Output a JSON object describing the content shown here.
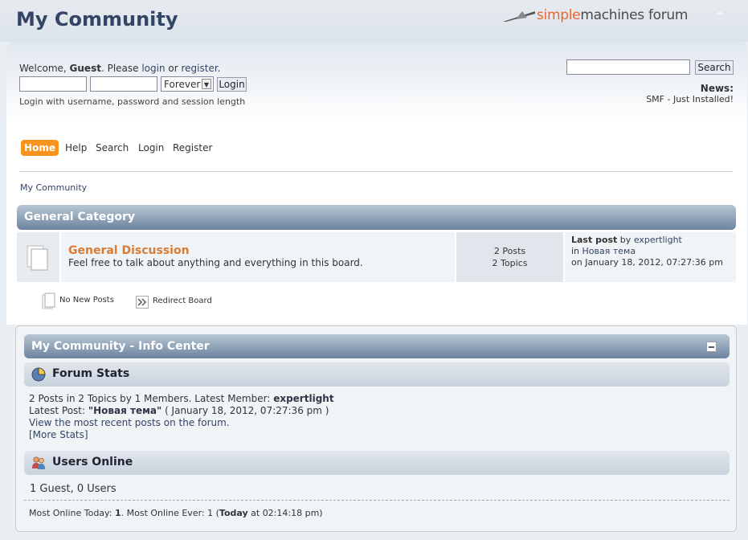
{
  "header": {
    "site_title": "My Community",
    "logo": {
      "simple": "simple",
      "machines": "machines",
      "forum": " forum"
    },
    "collapse_icon": "chevron-up-icon"
  },
  "user": {
    "welcome_prefix": "Welcome, ",
    "guest": "Guest",
    "welcome_mid": ". Please ",
    "login_link": "login",
    "or": " or ",
    "register_link": "register",
    "end": ".",
    "username_value": "",
    "password_value": "",
    "session_length": "Forever",
    "login_button": "Login",
    "login_hint": "Login with username, password and session length"
  },
  "search": {
    "value": "",
    "button": "Search"
  },
  "news": {
    "label": "News:",
    "text": "SMF - Just Installed!"
  },
  "menu": {
    "home": "Home",
    "help": "Help",
    "search": "Search",
    "login": "Login",
    "register": "Register"
  },
  "breadcrumb": "My Community",
  "category": {
    "title": "General Category",
    "board": {
      "name": "General Discussion",
      "description": "Feel free to talk about anything and everything in this board.",
      "posts": "2 Posts",
      "topics": "2 Topics",
      "last_post_label": "Last post",
      "last_post_by": " by ",
      "last_post_author": "expertlight",
      "last_post_in": "in ",
      "last_post_topic": "Новая тема",
      "last_post_on": "on January 18, 2012, 07:27:36 pm"
    }
  },
  "legend": {
    "no_new": "No New Posts",
    "redirect": "Redirect Board"
  },
  "info_center": {
    "title": "My Community - Info Center",
    "stats_title": "Forum Stats",
    "stats_line1_pre": "2 Posts in 2 Topics by 1 Members. Latest Member: ",
    "stats_line1_member": "expertlight",
    "stats_line2_pre": "Latest Post: ",
    "stats_line2_topic": "\"Новая тема\"",
    "stats_line2_post": " ( January 18, 2012, 07:27:36 pm )",
    "stats_line3": "View the most recent posts on the forum.",
    "stats_line4": "[More Stats]",
    "online_title": "Users Online",
    "online_line": "1 Guest, 0 Users",
    "most_online_pre": "Most Online Today: ",
    "most_online_today": "1",
    "most_online_mid": ". Most Online Ever: 1 (",
    "most_online_ever_when": "Today",
    "most_online_post": " at 02:14:18 pm)"
  },
  "colors": {
    "accent": "#f7941d",
    "header_bar": "#6c84a0",
    "board_link": "#d97b33"
  }
}
